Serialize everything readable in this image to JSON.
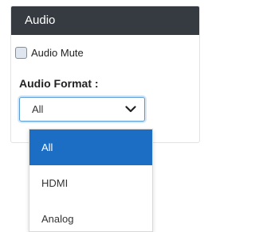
{
  "panel": {
    "title": "Audio",
    "mute": {
      "label": "Audio Mute",
      "checked": false
    },
    "format": {
      "label": "Audio Format :",
      "selected": "All",
      "options": [
        "All",
        "HDMI",
        "Analog"
      ]
    }
  },
  "colors": {
    "header_bg": "#363b41",
    "selected_option_bg": "#1c6ec4",
    "focus_border": "#5b9bd5"
  },
  "icons": {
    "select_arrow": "chevron-down-icon"
  }
}
